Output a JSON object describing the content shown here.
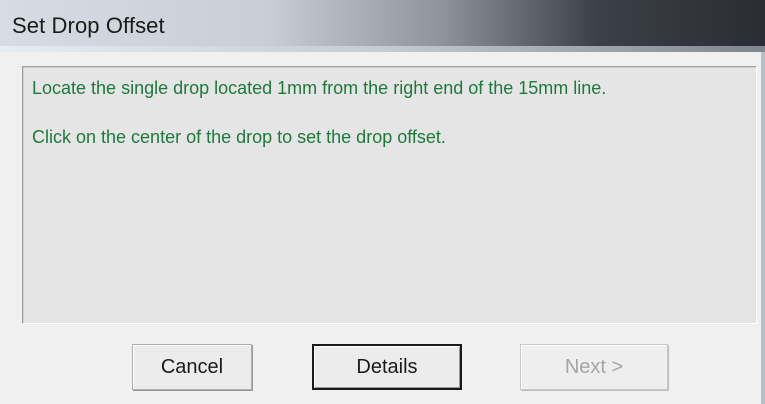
{
  "window": {
    "title": "Set Drop Offset"
  },
  "message": {
    "line1": "Locate the single drop located 1mm from the right end of the 15mm line.",
    "line2": "Click on the center of the drop to set the drop offset."
  },
  "buttons": {
    "cancel_label": "Cancel",
    "details_label": "Details",
    "next_label": "Next >"
  },
  "colors": {
    "message_text": "#1c7a3a",
    "panel_background": "#e5e5e5",
    "disabled_text": "#a6a6a6"
  }
}
